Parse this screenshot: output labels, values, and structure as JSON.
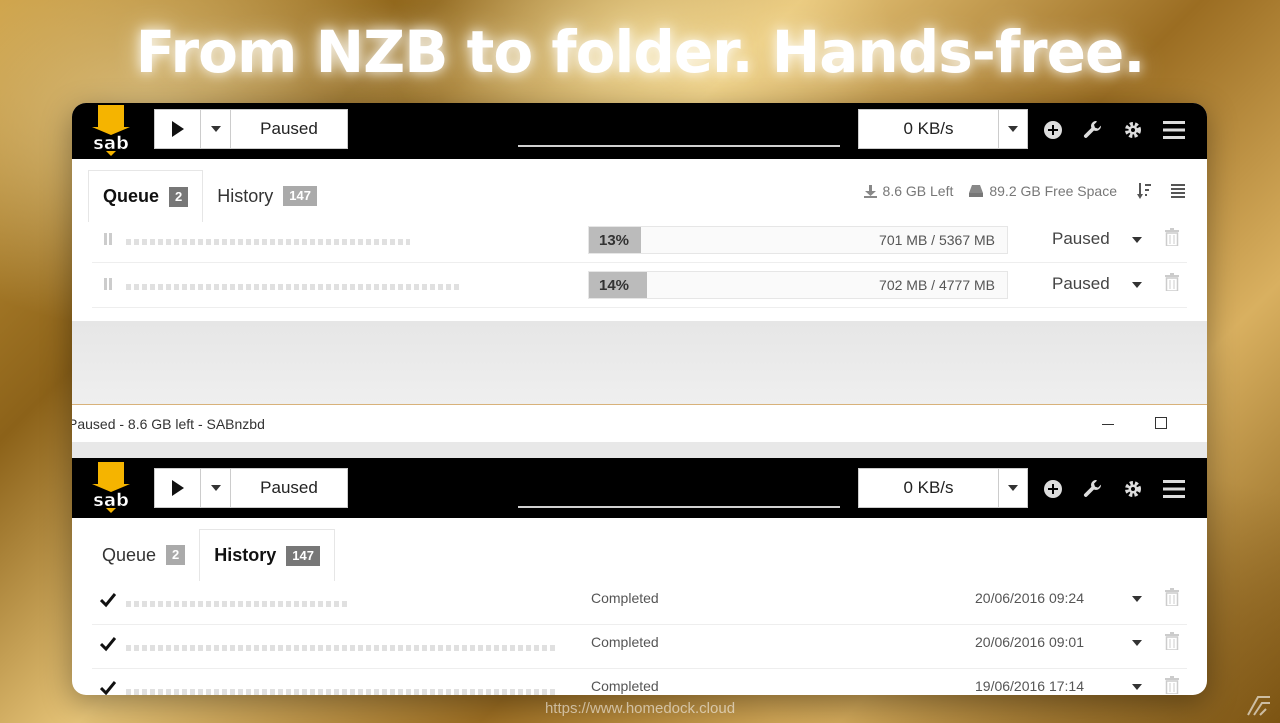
{
  "headline": "From NZB to folder. Hands-free.",
  "footer_url": "https://www.homedock.cloud",
  "colors": {
    "topbar": "#000000",
    "logo_yellow": "#f5b400",
    "badge_dark": "#777777",
    "badge_light": "#aaaaaa",
    "progress_fill": "#bbbbbb"
  },
  "window1": {
    "toolbar": {
      "logo": "sab",
      "pause_state": "Paused",
      "speed": "0 KB/s",
      "icons": [
        "add-icon",
        "wrench-icon",
        "gear-icon",
        "menu-icon"
      ]
    },
    "tabs": [
      {
        "label": "Queue",
        "count": "2",
        "active": true
      },
      {
        "label": "History",
        "count": "147",
        "active": false
      }
    ],
    "stats": {
      "left": "8.6 GB Left",
      "free": "89.2 GB Free Space"
    },
    "queue": [
      {
        "percent": "13%",
        "progress": 0.13,
        "size": "701 MB / 5367 MB",
        "status": "Paused"
      },
      {
        "percent": "14%",
        "progress": 0.14,
        "size": "702 MB / 4777 MB",
        "status": "Paused"
      }
    ]
  },
  "titlebar": {
    "text": "Paused - 8.6 GB left - SABnzbd"
  },
  "window2": {
    "toolbar": {
      "logo": "sab",
      "pause_state": "Paused",
      "speed": "0 KB/s"
    },
    "tabs": [
      {
        "label": "Queue",
        "count": "2",
        "active": false
      },
      {
        "label": "History",
        "count": "147",
        "active": true
      }
    ],
    "history": [
      {
        "status": "Completed",
        "date": "20/06/2016 09:24"
      },
      {
        "status": "Completed",
        "date": "20/06/2016 09:01"
      },
      {
        "status": "Completed",
        "date": "19/06/2016 17:14"
      }
    ]
  }
}
